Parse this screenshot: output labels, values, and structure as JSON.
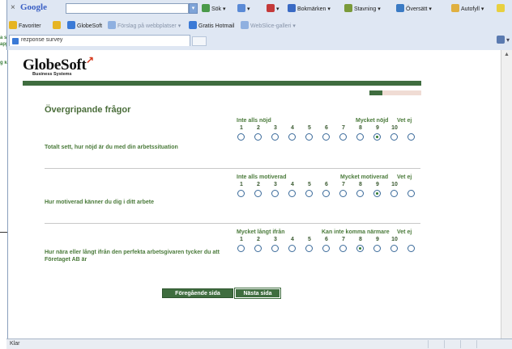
{
  "background": {
    "texts": [
      "a si",
      "app",
      "g ká"
    ]
  },
  "browser": {
    "toolbar": {
      "close": "×",
      "google": "Google",
      "search_button": "Sök",
      "bookmarks": "Bokmärken",
      "spelling": "Stavning",
      "translate": "Översätt",
      "autofill": "Autofyll"
    },
    "favorites": {
      "label": "Favoriter",
      "items": [
        {
          "label": "GlobeSoft",
          "dim": false
        },
        {
          "label": "Förslag på webbplatser",
          "dim": true
        },
        {
          "label": "Gratis Hotmail",
          "dim": false
        },
        {
          "label": "WebSlice-galleri",
          "dim": true
        }
      ]
    },
    "tab": {
      "title": "rezponse survey"
    },
    "status": "Klar"
  },
  "page": {
    "logo": "GlobeSoft",
    "logo_sub": "Business Systems",
    "progress": 0.25,
    "heading": "Övergripande frågor",
    "scale_numbers": [
      "1",
      "2",
      "3",
      "4",
      "5",
      "6",
      "7",
      "8",
      "9",
      "10"
    ],
    "questions": [
      {
        "low": "Inte alls nöjd",
        "high": "Mycket nöjd",
        "na": "Vet ej",
        "text": "Totalt sett, hur nöjd är du med din arbetssituation",
        "selected": 9
      },
      {
        "low": "Inte alls motiverad",
        "high": "Mycket motiverad",
        "na": "Vet ej",
        "text": "Hur motiverad känner du dig i ditt arbete",
        "selected": 9
      },
      {
        "low": "Mycket långt ifrån",
        "high": "Kan inte komma närmare",
        "na": "Vet ej",
        "text": "Hur nära eller långt ifrån den perfekta arbetsgivaren tycker du att Företaget AB är",
        "selected": 8
      }
    ],
    "buttons": {
      "prev": "Föregående sida",
      "next": "Nästa sida"
    }
  },
  "colors": {
    "brand_green": "#3f6d3f",
    "text_green": "#4a7a3a",
    "logo_accent": "#d63a1d"
  }
}
